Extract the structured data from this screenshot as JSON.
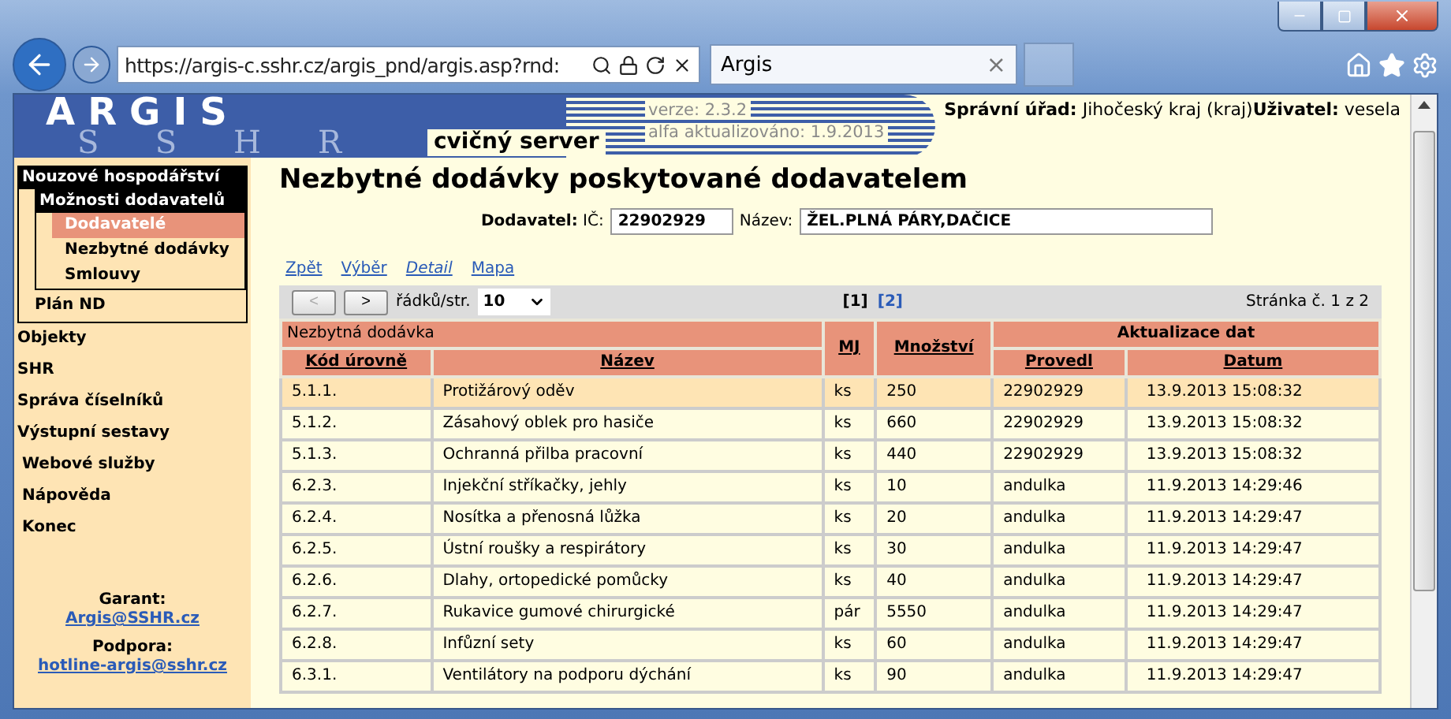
{
  "browser": {
    "address": "https://argis-c.sshr.cz/argis_pnd/argis.asp?rnd:",
    "tab_title": "Argis",
    "tab_close": "×"
  },
  "banner": {
    "logo": "ARGIS",
    "logo_watermark": "SSHR",
    "server_label": "cvičný server",
    "version": "verze: 2.3.2",
    "updated": "alfa aktualizováno: 1.9.2013",
    "office_label": "Správní úřad:",
    "office": "Jihočeský kraj (kraj)",
    "user_label": "Uživatel:",
    "user": "vesela"
  },
  "sidebar": {
    "items": [
      {
        "label": "Nouzové hospodářství",
        "selected": false,
        "children": [
          {
            "label": "Možnosti dodavatelů",
            "selected": false,
            "children": [
              {
                "label": "Dodavatelé",
                "selected": true
              },
              {
                "label": "Nezbytné dodávky",
                "selected": false
              },
              {
                "label": "Smlouvy",
                "selected": false
              }
            ]
          },
          {
            "label": "Plán ND",
            "selected": false
          }
        ]
      },
      {
        "label": "Objekty",
        "selected": false
      },
      {
        "label": "SHR",
        "selected": false
      },
      {
        "label": "Správa číselníků",
        "selected": false
      },
      {
        "label": "Výstupní sestavy",
        "selected": false
      },
      {
        "label": "Webové služby",
        "selected": false
      },
      {
        "label": "Nápověda",
        "selected": false
      },
      {
        "label": "Konec",
        "selected": false
      }
    ],
    "contacts": [
      {
        "label": "Garant:",
        "link": "Argis@SSHR.cz"
      },
      {
        "label": "Podpora:",
        "link": "hotline-argis@sshr.cz"
      }
    ]
  },
  "main": {
    "title": "Nezbytné dodávky poskytované dodavatelem",
    "supplier": {
      "label": "Dodavatel:",
      "ic_label": "IČ:",
      "ic": "22902929",
      "name_label": "Název:",
      "name": "ŽEL.PLNÁ PÁRY,DAČICE"
    },
    "links": [
      {
        "label": "Zpět",
        "selected": false
      },
      {
        "label": "Výběr",
        "selected": false
      },
      {
        "label": "Detail",
        "selected": true
      },
      {
        "label": "Mapa",
        "selected": false
      }
    ],
    "pager": {
      "prev": "<",
      "prev_disabled": true,
      "next": ">",
      "rows_label": "řádků/str.",
      "rows": "10",
      "pages": [
        {
          "label": "[1]",
          "selected": true
        },
        {
          "label": "[2]",
          "selected": false
        }
      ],
      "page_info": "Stránka č. 1 z 2"
    },
    "table": {
      "groups": [
        "Nezbytná dodávka",
        "Aktualizace dat"
      ],
      "columns": [
        "Kód úrovně",
        "Název",
        "MJ",
        "Množství",
        "Provedl",
        "Datum"
      ],
      "rows": [
        {
          "selected": true,
          "cells": [
            "5.1.1.",
            "Protižárový oděv",
            "ks",
            "250",
            "22902929",
            "13.9.2013 15:08:32"
          ]
        },
        {
          "selected": false,
          "cells": [
            "5.1.2.",
            "Zásahový oblek pro hasiče",
            "ks",
            "660",
            "22902929",
            "13.9.2013 15:08:32"
          ]
        },
        {
          "selected": false,
          "cells": [
            "5.1.3.",
            "Ochranná přilba pracovní",
            "ks",
            "440",
            "22902929",
            "13.9.2013 15:08:32"
          ]
        },
        {
          "selected": false,
          "cells": [
            "6.2.3.",
            "Injekční stříkačky, jehly",
            "ks",
            "10",
            "andulka",
            "11.9.2013 14:29:46"
          ]
        },
        {
          "selected": false,
          "cells": [
            "6.2.4.",
            "Nosítka a přenosná lůžka",
            "ks",
            "20",
            "andulka",
            "11.9.2013 14:29:47"
          ]
        },
        {
          "selected": false,
          "cells": [
            "6.2.5.",
            "Ústní roušky a respirátory",
            "ks",
            "30",
            "andulka",
            "11.9.2013 14:29:47"
          ]
        },
        {
          "selected": false,
          "cells": [
            "6.2.6.",
            "Dlahy, ortopedické pomůcky",
            "ks",
            "40",
            "andulka",
            "11.9.2013 14:29:47"
          ]
        },
        {
          "selected": false,
          "cells": [
            "6.2.7.",
            "Rukavice gumové chirurgické",
            "pár",
            "5550",
            "andulka",
            "11.9.2013 14:29:47"
          ]
        },
        {
          "selected": false,
          "cells": [
            "6.2.8.",
            "Infůzní sety",
            "ks",
            "60",
            "andulka",
            "11.9.2013 14:29:47"
          ]
        },
        {
          "selected": false,
          "cells": [
            "6.3.1.",
            "Ventilátory na podporu dýchání",
            "ks",
            "90",
            "andulka",
            "11.9.2013 14:29:47"
          ]
        }
      ]
    }
  }
}
